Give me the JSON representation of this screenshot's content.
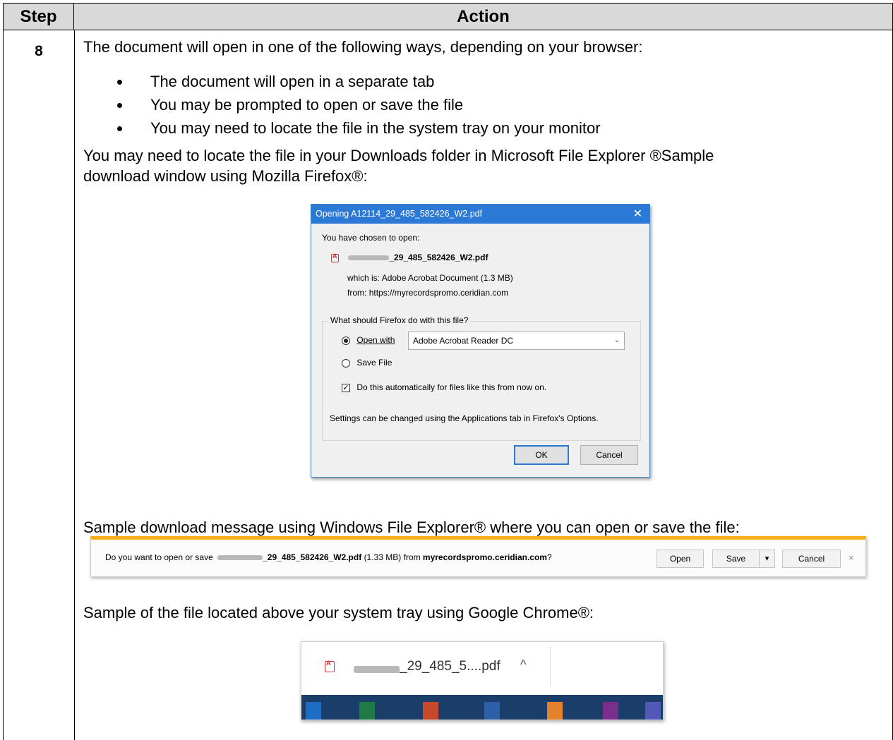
{
  "table": {
    "header_step": "Step",
    "header_action": "Action",
    "step_number": "8"
  },
  "content": {
    "intro": "The document will open in one of the following ways, depending on your browser:",
    "bullets": [
      "The document will open in a separate tab",
      "You may be prompted to open or save the file",
      "You may need to locate the file in the system tray on your monitor"
    ],
    "para_line1": "You may need to locate the file in your Downloads folder in Microsoft File Explorer ®Sample",
    "para_line2": "download window using Mozilla Firefox®:",
    "ie_caption": "Sample download message using Windows File Explorer® where you can open or save the file:",
    "chrome_caption": "Sample of the file located above your system tray using Google Chrome®:"
  },
  "firefox_dialog": {
    "title": "Opening A12114_29_485_582426_W2.pdf",
    "close": "✕",
    "chosen": "You have chosen to open:",
    "filename": "_29_485_582426_W2.pdf",
    "which_is_label": "which is:",
    "which_is_value": "Adobe Acrobat Document (1.3 MB)",
    "from_label": "from:",
    "from_value": "https://myrecordspromo.ceridian.com",
    "question": "What should Firefox do with this file?",
    "open_with": "Open with",
    "open_with_app": "Adobe Acrobat Reader DC",
    "save_file": "Save File",
    "auto": "Do this automatically for files like this from now on.",
    "settings": "Settings can be changed using the Applications tab in Firefox's Options.",
    "ok": "OK",
    "cancel": "Cancel",
    "accent": "#2b79d6"
  },
  "ie_bar": {
    "prefix": "Do you want to open or save",
    "filename": "_29_485_582426_W2.pdf",
    "size": "(1.33 MB) from",
    "site": "myrecordspromo.ceridian.com",
    "suffix": "?",
    "open": "Open",
    "save": "Save",
    "dropdown": "▾",
    "cancel": "Cancel",
    "close": "×",
    "accent": "#f5b01a"
  },
  "chrome_shelf": {
    "filename": "_29_485_5....pdf",
    "caret": "^"
  }
}
